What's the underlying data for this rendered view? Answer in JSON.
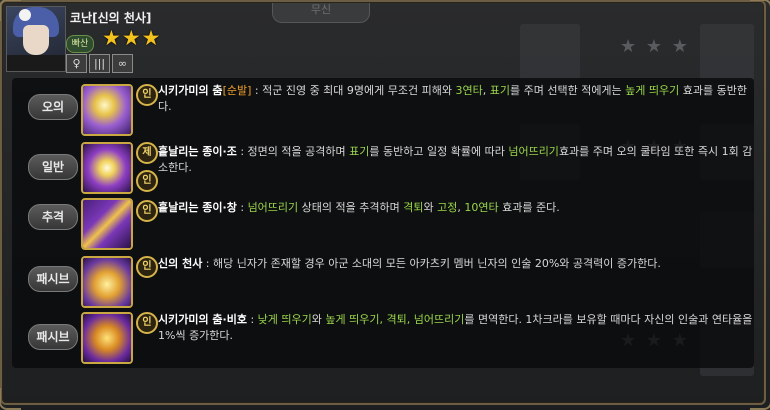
{
  "background": {
    "tab_label": "무신",
    "ghost_stars": [
      "★ ★ ★",
      "★ ★ ★",
      "★ ★ ★"
    ]
  },
  "character": {
    "name": "코난[신의 천사]",
    "badge": "빠산",
    "stars": "★★★",
    "stat_icons": [
      "♀",
      "|||",
      "∞"
    ]
  },
  "skills": [
    {
      "category": "오의",
      "mark": "인",
      "name": "시키가미의 춤",
      "name_tag": "[순발]",
      "segments": [
        {
          "t": " : 적군 진영 중 최대 9명에게 무조건 피해와 ",
          "c": ""
        },
        {
          "t": "3연타",
          "c": "g"
        },
        {
          "t": ", ",
          "c": ""
        },
        {
          "t": "표기",
          "c": "g"
        },
        {
          "t": "를 주며 선택한 적에게는 ",
          "c": ""
        },
        {
          "t": "높게 띄우기",
          "c": "g"
        },
        {
          "t": " 효과를 동반한다.",
          "c": ""
        }
      ]
    },
    {
      "category": "일반",
      "mark": "인",
      "mark2": "제",
      "name": "흩날리는 종이·조",
      "segments": [
        {
          "t": " : 정면의 적을 공격하며 ",
          "c": ""
        },
        {
          "t": "표기",
          "c": "g"
        },
        {
          "t": "를 동반하고 일정 확률에 따라 ",
          "c": ""
        },
        {
          "t": "넘어뜨리기",
          "c": "g"
        },
        {
          "t": "효과를 주며 오의 쿨타임 또한 즉시 1회 감소한다.",
          "c": ""
        }
      ]
    },
    {
      "category": "추격",
      "mark": "인",
      "name": "흩날리는 종이·창",
      "segments": [
        {
          "t": " : ",
          "c": ""
        },
        {
          "t": "넘어뜨리기",
          "c": "g"
        },
        {
          "t": " 상태의 적을 추격하며 ",
          "c": ""
        },
        {
          "t": "격퇴",
          "c": "g"
        },
        {
          "t": "와 ",
          "c": ""
        },
        {
          "t": "고정",
          "c": "g"
        },
        {
          "t": ", ",
          "c": ""
        },
        {
          "t": "10연타",
          "c": "g"
        },
        {
          "t": " 효과를 준다.",
          "c": ""
        }
      ]
    },
    {
      "category": "패시브",
      "mark": "인",
      "name": "신의 천사",
      "segments": [
        {
          "t": " : 해당 닌자가 존재할 경우 아군 소대의 모든 아카츠키 멤버 닌자의 인술 20%와 공격력이 증가한다.",
          "c": ""
        }
      ]
    },
    {
      "category": "패시브",
      "mark": "인",
      "name": "시키가미의 춤·비호",
      "segments": [
        {
          "t": " : ",
          "c": ""
        },
        {
          "t": "낮게 띄우기",
          "c": "g"
        },
        {
          "t": "와 ",
          "c": ""
        },
        {
          "t": "높게 띄우기, 격퇴, 넘어뜨리기",
          "c": "g"
        },
        {
          "t": "를 면역한다.  1차크라를 보유할 때마다 자신의 인술과 연타율을 1%씩 증가한다.",
          "c": ""
        }
      ]
    }
  ]
}
